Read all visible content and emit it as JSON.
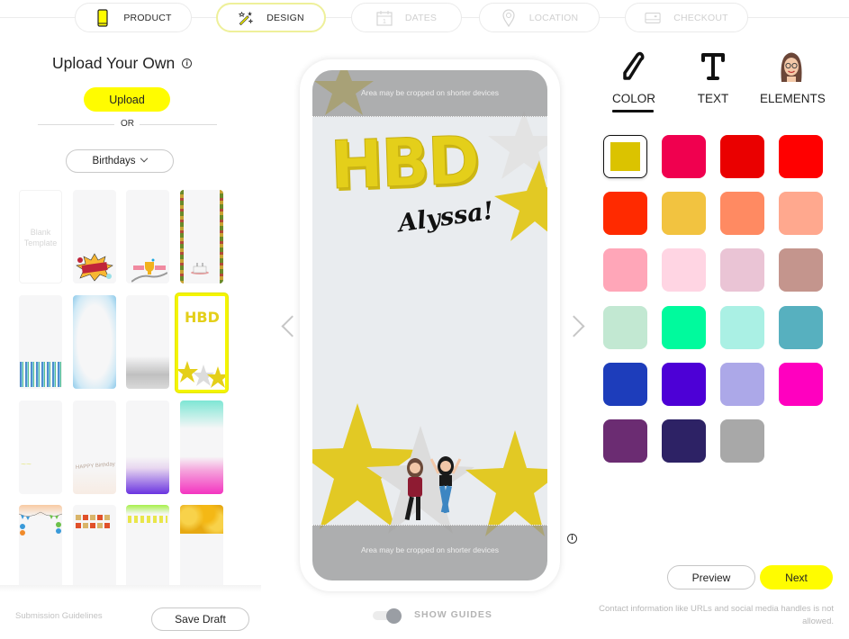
{
  "steps": [
    {
      "label": "PRODUCT",
      "icon": "phone-icon",
      "state": "done"
    },
    {
      "label": "DESIGN",
      "icon": "magic-wand-icon",
      "state": "active"
    },
    {
      "label": "DATES",
      "icon": "calendar-icon",
      "state": "disabled"
    },
    {
      "label": "LOCATION",
      "icon": "location-pin-icon",
      "state": "disabled"
    },
    {
      "label": "CHECKOUT",
      "icon": "credit-card-icon",
      "state": "disabled"
    }
  ],
  "left_panel": {
    "title": "Upload Your Own",
    "info_icon": "info-icon",
    "upload_label": "Upload",
    "or_label": "OR",
    "category_selected": "Birthdays",
    "blank_template_label": "Blank Template",
    "templates": [
      "Blank Template",
      "Happy Birthday comic burst",
      "Trophy confetti",
      "Cake with light border",
      "Candles",
      "Blue confetti",
      "Silver glitter",
      "HBD balloons stars",
      "Yellow doodle",
      "Happy Birthday script",
      "Purple party",
      "Unicorns gradient",
      "Bunting balloons",
      "Happy Birthday banner",
      "Green pennants",
      "Gold balloons Happy Birthday"
    ],
    "selected_template_index": 7,
    "submission_guidelines": "Submission Guidelines",
    "save_draft_label": "Save Draft"
  },
  "preview": {
    "crop_notice_top": "Area may be cropped on shorter devices",
    "crop_notice_bottom": "Area may be cropped on shorter devices",
    "headline": "HBD",
    "name_text": "Alyssa!",
    "show_guides_label": "SHOW GUIDES",
    "show_guides_on": true
  },
  "right_panel": {
    "tabs": [
      {
        "label": "COLOR",
        "icon": "pencil-icon",
        "active": true
      },
      {
        "label": "TEXT",
        "icon": "text-t-icon",
        "active": false
      },
      {
        "label": "ELEMENTS",
        "icon": "bitmoji-avatar-icon",
        "active": false
      }
    ],
    "colors": [
      "#dbc300",
      "#f0004f",
      "#ea0000",
      "#ff0000",
      "#ff2a00",
      "#f2c340",
      "#ff8a62",
      "#ffa88e",
      "#ffa6b8",
      "#ffd5e3",
      "#eac4d5",
      "#c4958d",
      "#c2e8d2",
      "#00fa9d",
      "#aaf0e4",
      "#57b0bf",
      "#1d3dbb",
      "#4d00d6",
      "#aca8e8",
      "#ff00bf",
      "#6b2c72",
      "#2d2265",
      "#a8a8a8"
    ],
    "selected_color_index": 0,
    "preview_label": "Preview",
    "next_label": "Next",
    "contact_note": "Contact information like URLs and social media handles is not allowed."
  },
  "accent": {
    "yellow": "#fffc00",
    "selected_outline": "#f4f500"
  }
}
